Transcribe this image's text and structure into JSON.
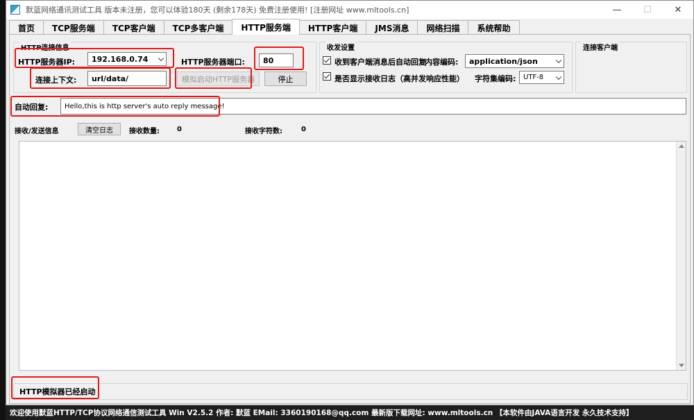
{
  "window": {
    "title": "默蓝网络通讯测试工具 版本未注册，您可以体验180天 (剩余178天) 免费注册使用! [注册网址 www.mltools.cn]",
    "minimize": "—",
    "maximize": "☐",
    "close": "✕"
  },
  "tabs": [
    "首页",
    "TCP服务端",
    "TCP客户端",
    "TCP多客户端",
    "HTTP服务端",
    "HTTP客户端",
    "JMS消息",
    "网络扫描",
    "系统帮助"
  ],
  "connection_group": {
    "title": "HTTP连接信息",
    "server_ip_label": "HTTP服务器IP:",
    "server_ip_value": "192.168.0.74",
    "port_label": "HTTP服务器端口:",
    "port_value": "80",
    "context_label": "连接上下文:",
    "context_value": "url/data/",
    "start_button": "模拟启动HTTP服务器",
    "stop_button": "停止"
  },
  "settings_group": {
    "title": "收发设置",
    "auto_reply_check_label": "收到客户端消息后自动回复",
    "content_type_label": "内容编码:",
    "content_type_value": "application/json",
    "show_log_check_label": "是否显示接收日志（高并发响应性能）",
    "charset_label": "字符集编码:",
    "charset_value": "UTF-8"
  },
  "clients_group": {
    "title": "连接客户端"
  },
  "auto_reply": {
    "label": "自动回复:",
    "value": "Hello,this is http server's auto reply message!"
  },
  "log_bar": {
    "label": "接收/发送信息",
    "clear_button": "清空日志",
    "recv_count_label": "接收数量:",
    "recv_count_value": "0",
    "recv_chars_label": "接收字符数:",
    "recv_chars_value": "0"
  },
  "status": "HTTP模拟器已经启动",
  "footer": "欢迎使用默蓝HTTP/TCP协议网络通信测试工具 Win V2.5.2 作者: 默蓝  EMail: 3360190168@qq.com 最新版下载网址: www.mltools.cn  【本软件由JAVA语言开发  永久技术支持】",
  "colors": {
    "highlight_box": "#e01919",
    "footer_bg": "#1e1e1e"
  }
}
